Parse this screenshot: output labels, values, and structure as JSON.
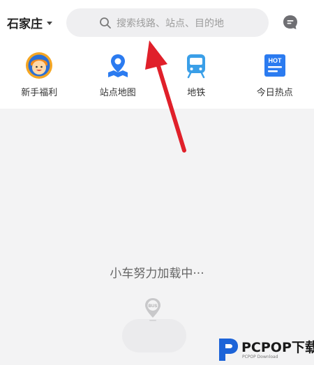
{
  "header": {
    "city": "石家庄",
    "search_placeholder": "搜索线路、站点、目的地"
  },
  "quick_entries": [
    {
      "label": "新手福利",
      "icon": "avatar-icon"
    },
    {
      "label": "站点地图",
      "icon": "map-pin-icon"
    },
    {
      "label": "地铁",
      "icon": "subway-train-icon"
    },
    {
      "label": "今日热点",
      "icon": "hot-news-icon",
      "badge": "HOT"
    }
  ],
  "main": {
    "loading_text": "小车努力加载中···",
    "marker_label": "BUS"
  },
  "watermark": {
    "brand": "PCPOP下载",
    "sub": "PCPOP Download"
  },
  "colors": {
    "accent_blue": "#2b7bf0",
    "arrow_red": "#e0202a",
    "background_gray": "#f3f3f4"
  }
}
